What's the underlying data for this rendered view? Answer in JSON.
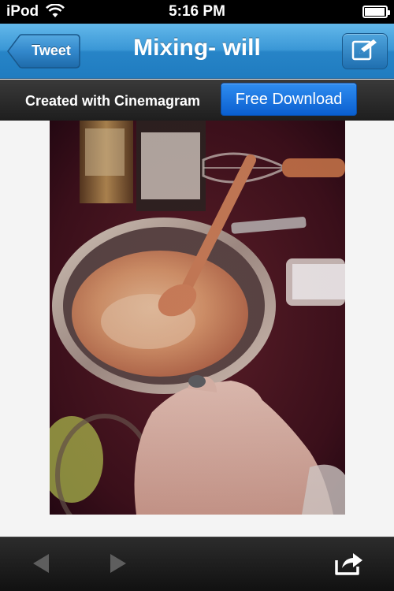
{
  "status_bar": {
    "carrier": "iPod",
    "time": "5:16 PM",
    "battery_level": 0.95
  },
  "nav": {
    "back_label": "Tweet",
    "title": "Mixing- will",
    "compose_icon": "compose-icon"
  },
  "promo": {
    "text": "Created with Cinemagram",
    "button_label": "Free Download"
  },
  "photo": {
    "description_icon": "photo-image"
  },
  "toolbar": {
    "back_icon": "arrow-left-icon",
    "forward_icon": "arrow-right-icon",
    "share_icon": "share-icon"
  },
  "colors": {
    "nav_blue": "#2f8fd6",
    "download_blue": "#1a72e0",
    "toolbar_dark": "#1a1a1a"
  }
}
